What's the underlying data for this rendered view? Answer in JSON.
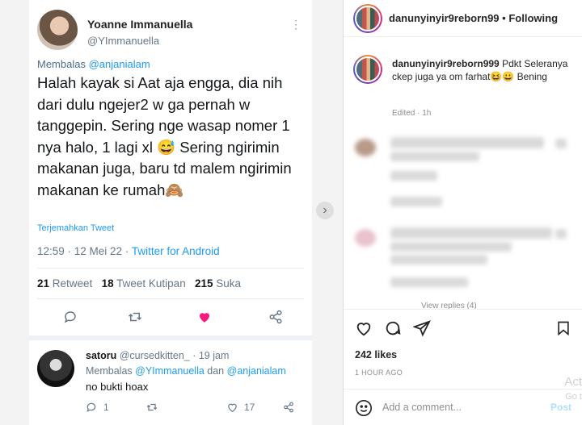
{
  "tweet": {
    "display_name": "Yoanne Immanuella",
    "handle": "@YImmanuella",
    "replying_prefix": "Membalas",
    "replying_to": "@anjanialam",
    "body": "Halah kayak si Aat aja engga, dia nih dari dulu ngejer2 w ga pernah w tanggepin. Sering nge wasap nomer 1 nya halo, 1 lagi xl 😅 Sering ngirimin makanan juga, baru td malem ngirimin makanan ke rumah🙈",
    "translate": "Terjemahkan Tweet",
    "timestamp": "12:59 · 12 Mei 22 · ",
    "source": "Twitter for Android",
    "retweets_count": "21",
    "retweets_label": "Retweet",
    "quotes_count": "18",
    "quotes_label": "Tweet Kutipan",
    "likes_count": "215",
    "likes_label": "Suka"
  },
  "reply": {
    "name": "satoru",
    "handle_time": "@cursedkitten_ · 19 jam",
    "replying_prefix": "Membalas",
    "mention1": "@YImmanuella",
    "and": "dan",
    "mention2": "@anjanialam",
    "body": "no bukti hoax",
    "reply_count": "1",
    "like_count": "17"
  },
  "instagram": {
    "username": "danunyinyir9reborn99",
    "following": "Following",
    "separator": "•",
    "caption_user": "danunyinyir9reborn999",
    "caption_text": "Pdkt Seleranya ckep juga ya om farhat😆😀 Bening",
    "edited": "Edited · 1h",
    "view_replies": "View replies (4)",
    "likes": "242 likes",
    "time": "1 HOUR AGO",
    "comment_placeholder": "Add a comment...",
    "post": "Post",
    "watermark1": "Act",
    "watermark2": "Go t"
  },
  "colors": {
    "twitter_blue": "#1d9bf0",
    "like_pink": "#f91880",
    "ig_text": "#262626"
  },
  "icons": [
    "reply-icon",
    "retweet-icon",
    "heart-icon",
    "share-icon",
    "more-icon",
    "chevron-right-icon",
    "like-icon",
    "comment-icon",
    "send-icon",
    "bookmark-icon",
    "emoji-icon"
  ]
}
